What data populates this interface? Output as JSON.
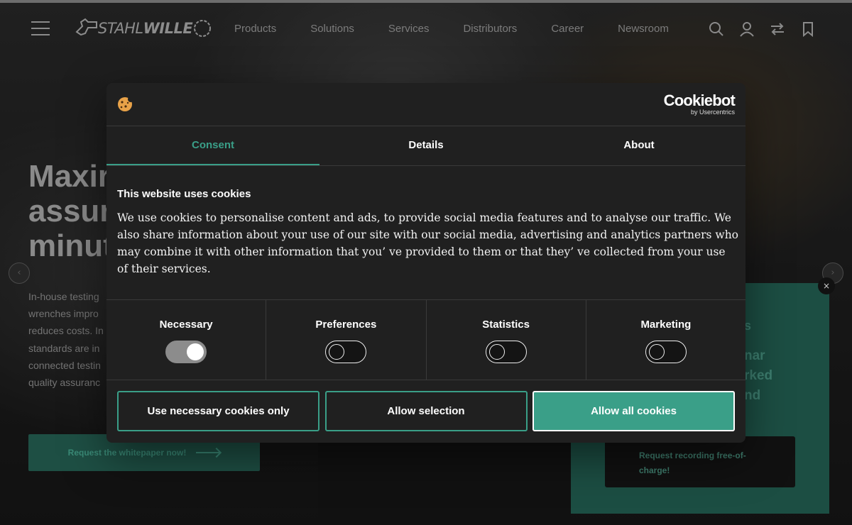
{
  "site": {
    "logo_text_light": "STAHL",
    "logo_text_bold": "WILLE",
    "nav": [
      "Products",
      "Solutions",
      "Services",
      "Distributors",
      "Career",
      "Newsroom"
    ],
    "header_icons": [
      "search-icon",
      "user-icon",
      "compare-icon",
      "bookmark-icon"
    ]
  },
  "hero": {
    "heading_lines": [
      "Maxir",
      "assur",
      "minut"
    ],
    "lede_lines": [
      "In-house testing",
      "wrenches impro",
      "reduces costs. In",
      "standards are in",
      "connected testin",
      "quality assuranc"
    ],
    "cta_label": "Request the whitepaper now!"
  },
  "promo": {
    "fragments": [
      "s",
      "nar",
      "rked",
      "nd"
    ],
    "button_label": "Request recording free-of-charge!",
    "close_label": "×"
  },
  "dialog": {
    "brand": "Cookiebot",
    "brand_sub": "by Usercentrics",
    "tabs": [
      {
        "label": "Consent",
        "active": true
      },
      {
        "label": "Details",
        "active": false
      },
      {
        "label": "About",
        "active": false
      }
    ],
    "title": "This website uses cookies",
    "body_lines": [
      "We use cookies to personalise content and ads, to provide social media features and to analyse our traffic. We",
      "also share information about your use of our site with our social media, advertising and analytics partners who",
      "may combine it with other information that you’ ve provided to them or that they’ ve collected from your use",
      "of their services."
    ],
    "toggles": [
      {
        "label": "Necessary",
        "on": true
      },
      {
        "label": "Preferences",
        "on": false
      },
      {
        "label": "Statistics",
        "on": false
      },
      {
        "label": "Marketing",
        "on": false
      }
    ],
    "buttons": {
      "necessary_only": "Use necessary cookies only",
      "allow_selection": "Allow selection",
      "allow_all": "Allow all cookies"
    }
  },
  "colors": {
    "accent": "#3a9f88",
    "dialog_bg": "#202020"
  }
}
